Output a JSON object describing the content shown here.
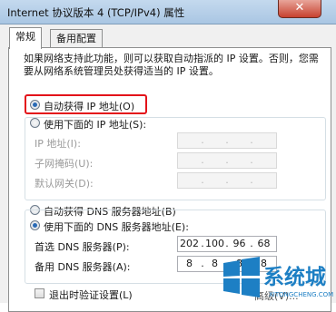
{
  "window": {
    "title": "Internet 协议版本 4 (TCP/IPv4) 属性",
    "close_glyph": "✕"
  },
  "tabs": [
    {
      "label": "常规"
    },
    {
      "label": "备用配置"
    }
  ],
  "description": "如果网络支持此功能，则可以获取自动指派的 IP 设置。否则，您需要从网络系统管理员处获得适当的 IP 设置。",
  "ip_mode": {
    "auto_label": "自动获得 IP 地址(O)",
    "auto_selected": true,
    "manual_label": "使用下面的 IP 地址(S):"
  },
  "ip_fields": [
    {
      "label": "IP 地址(I):"
    },
    {
      "label": "子网掩码(U):"
    },
    {
      "label": "默认网关(D):"
    }
  ],
  "dns_mode": {
    "auto_label": "自动获得 DNS 服务器地址(B)",
    "manual_label": "使用下面的 DNS 服务器地址(E):",
    "manual_selected": true
  },
  "dns_fields": {
    "preferred": {
      "label": "首选 DNS 服务器(P):",
      "octets": [
        "202",
        "100",
        "96",
        "68"
      ]
    },
    "alternate": {
      "label": "备用 DNS 服务器(A):",
      "octets": [
        "8",
        "8",
        "8",
        "8"
      ]
    }
  },
  "validate": {
    "label": "退出时验证设置(L)"
  },
  "advanced_button": {
    "label": "高级(V)..."
  },
  "watermark": {
    "text": "系统城",
    "sub": "XITONGCHENG.COM",
    "color": "#1d7fc4"
  }
}
